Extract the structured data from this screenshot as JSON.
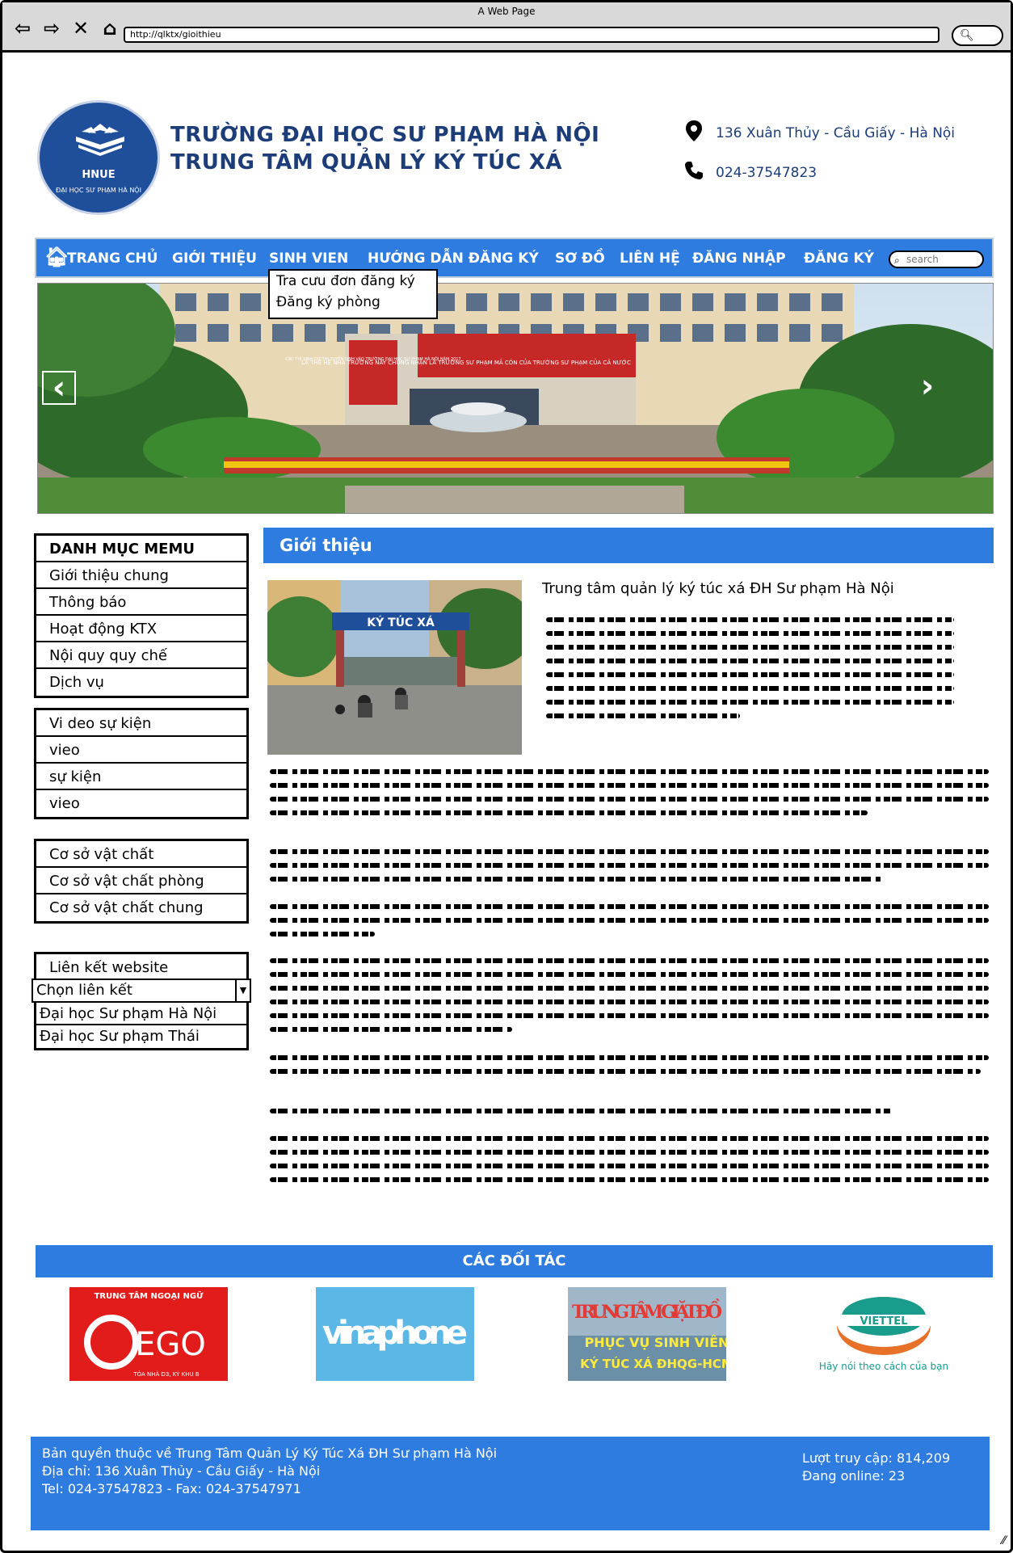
{
  "window": {
    "title": "A Web Page",
    "url": "http://qlktx/gioithieu"
  },
  "header": {
    "logo_text": "HNUE",
    "logo_ring": "ĐẠI HỌC SƯ PHẠM HÀ NỘI",
    "school_line1": "TRƯỜNG ĐẠI HỌC SƯ PHẠM HÀ NỘI",
    "school_line2": "TRUNG TÂM QUẢN LÝ KÝ TÚC XÁ",
    "address": "136 Xuân Thủy - Cầu Giấy - Hà Nội",
    "phone": "024-37547823"
  },
  "nav": {
    "items": [
      "TRANG CHỦ",
      "GIỚI THIỆU",
      "SINH VIEN",
      "HƯỚNG DẪN ĐĂNG KÝ",
      "SƠ ĐỒ",
      "LIÊN HỆ",
      "ĐĂNG NHẬP",
      "ĐĂNG KÝ"
    ],
    "search_placeholder": "search",
    "dropdown": [
      "Tra cưu đơn đăng ký",
      "Đăng ký phòng"
    ]
  },
  "slider": {
    "banner_red": "CÁC THÍ SINH DỰ THI TUYỂN SINH VÀO TRƯỜNG ĐẠI HỌC SƯ PHẠM HÀ NỘI NĂM 2017",
    "banner_main": "LÀ THẾ HỆ NHÀ TRƯỜNG NÀY CHỦNG NHẬN LÀ TRƯỜNG SƯ PHẠM MÃ CÓN CỦA TRƯỜNG SƯ PHẠM CỦA CẢ NƯỚC"
  },
  "sidebar": {
    "menu1": [
      "DANH MỤC MEMU",
      "Giới thiệu chung",
      "Thông báo",
      "Hoạt động KTX",
      "Nội quy quy chế",
      "Dịch vụ"
    ],
    "menu2": [
      "Vi deo sự kiện",
      "vieo",
      "sự kiện",
      "vieo"
    ],
    "menu3": [
      "Cơ sở vật chất",
      "Cơ sở vật chất phòng",
      "Cơ sở vật chất chung"
    ],
    "links_title": "Liên kết website",
    "links_select": "Chọn liên kết",
    "links": [
      "Đại học Sư phạm Hà Nội",
      "Đại học Sư phạm Thái"
    ]
  },
  "content": {
    "section_title": "Giới thiệu",
    "article_title": "Trung tâm quản lý ký túc xá ĐH Sư phạm Hà Nội",
    "gate_sign": "KÝ TÚC XÁ"
  },
  "partners": {
    "title": "CÁC ĐỐI TÁC",
    "ego_top": "TRUNG TÂM NGOẠI NGỮ",
    "ego_name": "EGO",
    "ego_sub": "TÒA NHÀ D3, KÝ KHU B",
    "vinaphone": "vinaphone",
    "laundry1": "TRUNG TÂM GIẶT ĐỒ",
    "laundry2": "PHỤC VỤ SINH VIÊN",
    "laundry3": "KÝ TÚC XÁ ĐHQG-HCM",
    "viettel": "VIETTEL",
    "viettel_slogan": "Hãy nói theo cách của bạn"
  },
  "footer": {
    "line1": "Bản quyền thuộc về Trung Tâm Quản Lý Ký Túc Xá ĐH Sư phạm Hà Nội",
    "line2": "Địa chỉ: 136 Xuân Thủy - Cầu Giấy - Hà Nội",
    "line3": "Tel: 024-37547823 - Fax: 024-37547971",
    "visits": "Lượt truy cập: 814,209",
    "online": "Đang online: 23"
  },
  "colors": {
    "accent": "#2f7ce0",
    "navy": "#1d3d78"
  }
}
